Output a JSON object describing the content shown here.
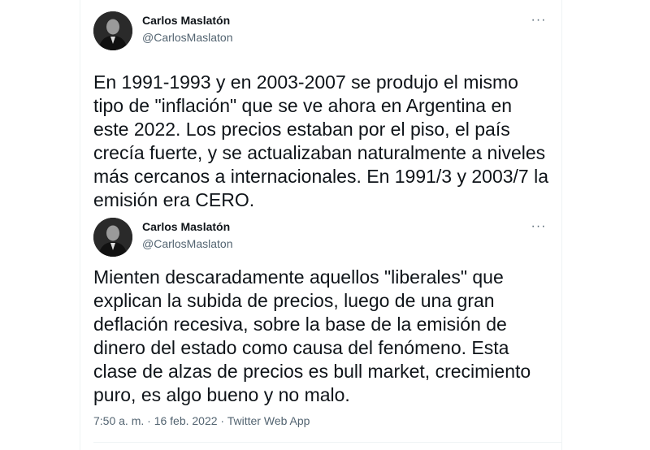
{
  "tweets": [
    {
      "author_name": "Carlos Maslatón",
      "author_handle": "@CarlosMaslaton",
      "more_icon": "more-horizontal-icon",
      "text_lines": [
        "En 1991-1993 y en 2003-2007 se produjo el mismo",
        "tipo de \"inflación\" que se ve ahora en Argentina en",
        "este 2022. Los precios estaban por el piso, el país",
        "crecía fuerte, y se actualizaban naturalmente a niveles",
        "más cercanos a internacionales. En 1991/3 y 2003/7 la",
        "emisión era CERO."
      ]
    },
    {
      "author_name": "Carlos Maslatón",
      "author_handle": "@CarlosMaslaton",
      "more_icon": "more-horizontal-icon",
      "text_lines": [
        "Mienten descaradamente aquellos \"liberales\" que",
        "explican la subida de precios, luego de una gran",
        "deflación recesiva, sobre la base de la emisión de",
        "dinero del estado como causa del fenómeno. Esta",
        "clase de alzas de precios es bull market, crecimiento",
        "puro, es algo bueno y no malo."
      ],
      "timestamp": "7:50 a. m. · 16 feb. 2022 · ",
      "source": "Twitter Web App"
    }
  ]
}
